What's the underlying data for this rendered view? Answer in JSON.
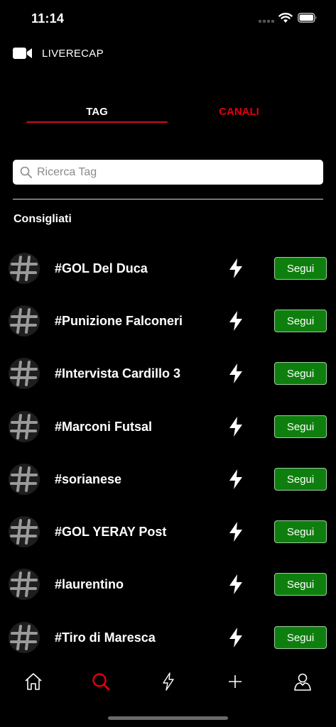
{
  "status_bar": {
    "time": "11:14"
  },
  "app": {
    "title": "LIVERECAP",
    "icon": "video-camera-icon"
  },
  "tabs": [
    {
      "label": "TAG",
      "active": true
    },
    {
      "label": "CANALI",
      "active": false
    }
  ],
  "search": {
    "placeholder": "Ricerca Tag",
    "value": ""
  },
  "section": {
    "title": "Consigliati"
  },
  "tags": [
    {
      "name": "#GOL Del Duca",
      "button": "Segui"
    },
    {
      "name": "#Punizione Falconeri",
      "button": "Segui"
    },
    {
      "name": "#Intervista Cardillo 3",
      "button": "Segui"
    },
    {
      "name": "#Marconi Futsal",
      "button": "Segui"
    },
    {
      "name": "#sorianese",
      "button": "Segui"
    },
    {
      "name": "#GOL YERAY Post",
      "button": "Segui"
    },
    {
      "name": "#laurentino",
      "button": "Segui"
    },
    {
      "name": "#Tiro di Maresca",
      "button": "Segui"
    }
  ],
  "bottom_nav": [
    {
      "icon": "home-icon",
      "active": false
    },
    {
      "icon": "search-icon",
      "active": true
    },
    {
      "icon": "lightning-icon",
      "active": false
    },
    {
      "icon": "plus-icon",
      "active": false
    },
    {
      "icon": "profile-icon",
      "active": false
    }
  ],
  "colors": {
    "background": "#000000",
    "accent_red": "#e0000f",
    "follow_green": "#0e7f0e"
  }
}
